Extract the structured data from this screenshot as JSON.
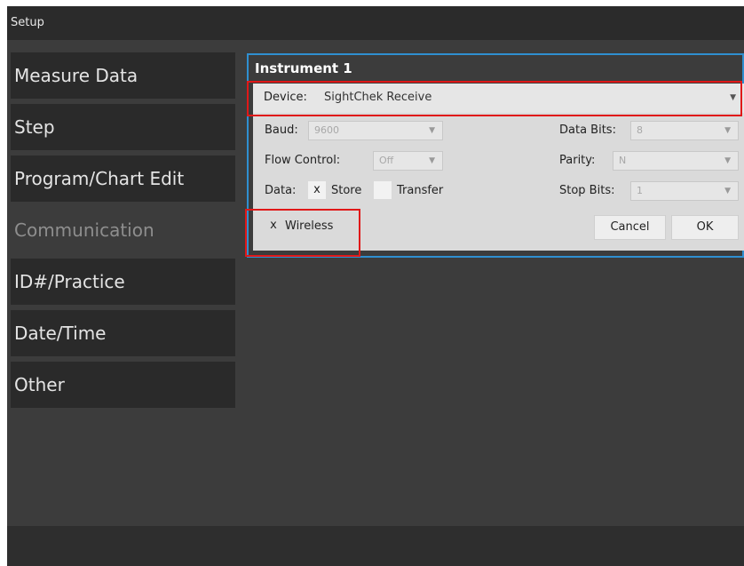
{
  "window": {
    "title": "Setup"
  },
  "sidebar": {
    "items": [
      {
        "label": "Measure Data"
      },
      {
        "label": "Step"
      },
      {
        "label": "Program/Chart Edit"
      },
      {
        "label": "Communication",
        "selected": true
      },
      {
        "label": "ID#/Practice"
      },
      {
        "label": "Date/Time"
      },
      {
        "label": "Other"
      }
    ]
  },
  "dialog": {
    "title": "Instrument 1",
    "device": {
      "label": "Device:",
      "value": "SightChek Receive",
      "highlighted": true
    },
    "baud": {
      "label": "Baud:",
      "value": "9600"
    },
    "data_bits": {
      "label": "Data Bits:",
      "value": "8"
    },
    "flow_control": {
      "label": "Flow Control:",
      "value": "Off"
    },
    "parity": {
      "label": "Parity:",
      "value": "N"
    },
    "data": {
      "label": "Data:",
      "store": {
        "mark": "x",
        "label": "Store",
        "checked": true
      },
      "transfer": {
        "mark": "",
        "label": "Transfer",
        "checked": false
      }
    },
    "stop_bits": {
      "label": "Stop Bits:",
      "value": "1"
    },
    "wireless": {
      "mark": "x",
      "label": "Wireless",
      "checked": true,
      "highlighted": true
    },
    "cancel_label": "Cancel",
    "ok_label": "OK"
  },
  "icons": {
    "dropdown": "triangle-down-icon"
  },
  "colors": {
    "dialog_border": "#2f8fd0",
    "highlight": "#e01818",
    "panel": "#dadada",
    "background": "#3c3c3c"
  }
}
